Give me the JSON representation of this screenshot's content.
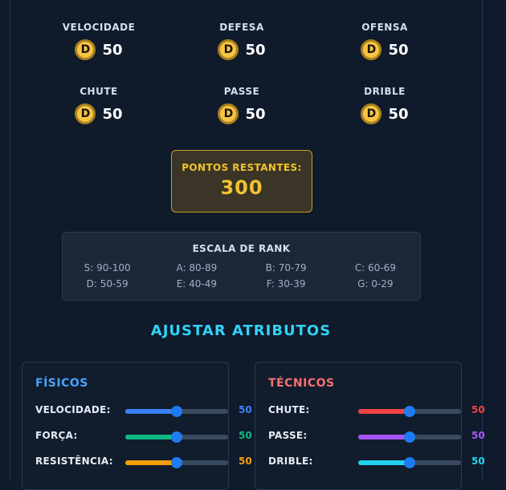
{
  "stats": [
    {
      "label": "VELOCIDADE",
      "grade": "D",
      "value": "50"
    },
    {
      "label": "DEFESA",
      "grade": "D",
      "value": "50"
    },
    {
      "label": "OFENSA",
      "grade": "D",
      "value": "50"
    },
    {
      "label": "CHUTE",
      "grade": "D",
      "value": "50"
    },
    {
      "label": "PASSE",
      "grade": "D",
      "value": "50"
    },
    {
      "label": "DRIBLE",
      "grade": "D",
      "value": "50"
    }
  ],
  "points": {
    "label": "PONTOS RESTANTES:",
    "value": "300"
  },
  "rank_scale": {
    "title": "ESCALA DE RANK",
    "items": [
      "S: 90-100",
      "A: 80-89",
      "B: 70-79",
      "C: 60-69",
      "D: 50-59",
      "E: 40-49",
      "F: 30-39",
      "G: 0-29"
    ]
  },
  "adjust_title": "AJUSTAR ATRIBUTOS",
  "physical": {
    "title": "FÍSICOS",
    "title_color": "#4aa3ff",
    "rows": [
      {
        "label": "VELOCIDADE:",
        "value": "50",
        "level": 0.5,
        "color": "#3b82f6"
      },
      {
        "label": "FORÇA:",
        "value": "50",
        "level": 0.5,
        "color": "#10b981"
      },
      {
        "label": "RESISTÊNCIA:",
        "value": "50",
        "level": 0.5,
        "color": "#f59e0b"
      }
    ]
  },
  "technical": {
    "title": "TÉCNICOS",
    "title_color": "#f87171",
    "rows": [
      {
        "label": "CHUTE:",
        "value": "50",
        "level": 0.5,
        "color": "#ef4444"
      },
      {
        "label": "PASSE:",
        "value": "50",
        "level": 0.5,
        "color": "#a855f7"
      },
      {
        "label": "DRIBLE:",
        "value": "50",
        "level": 0.5,
        "color": "#22d3ee"
      }
    ]
  }
}
